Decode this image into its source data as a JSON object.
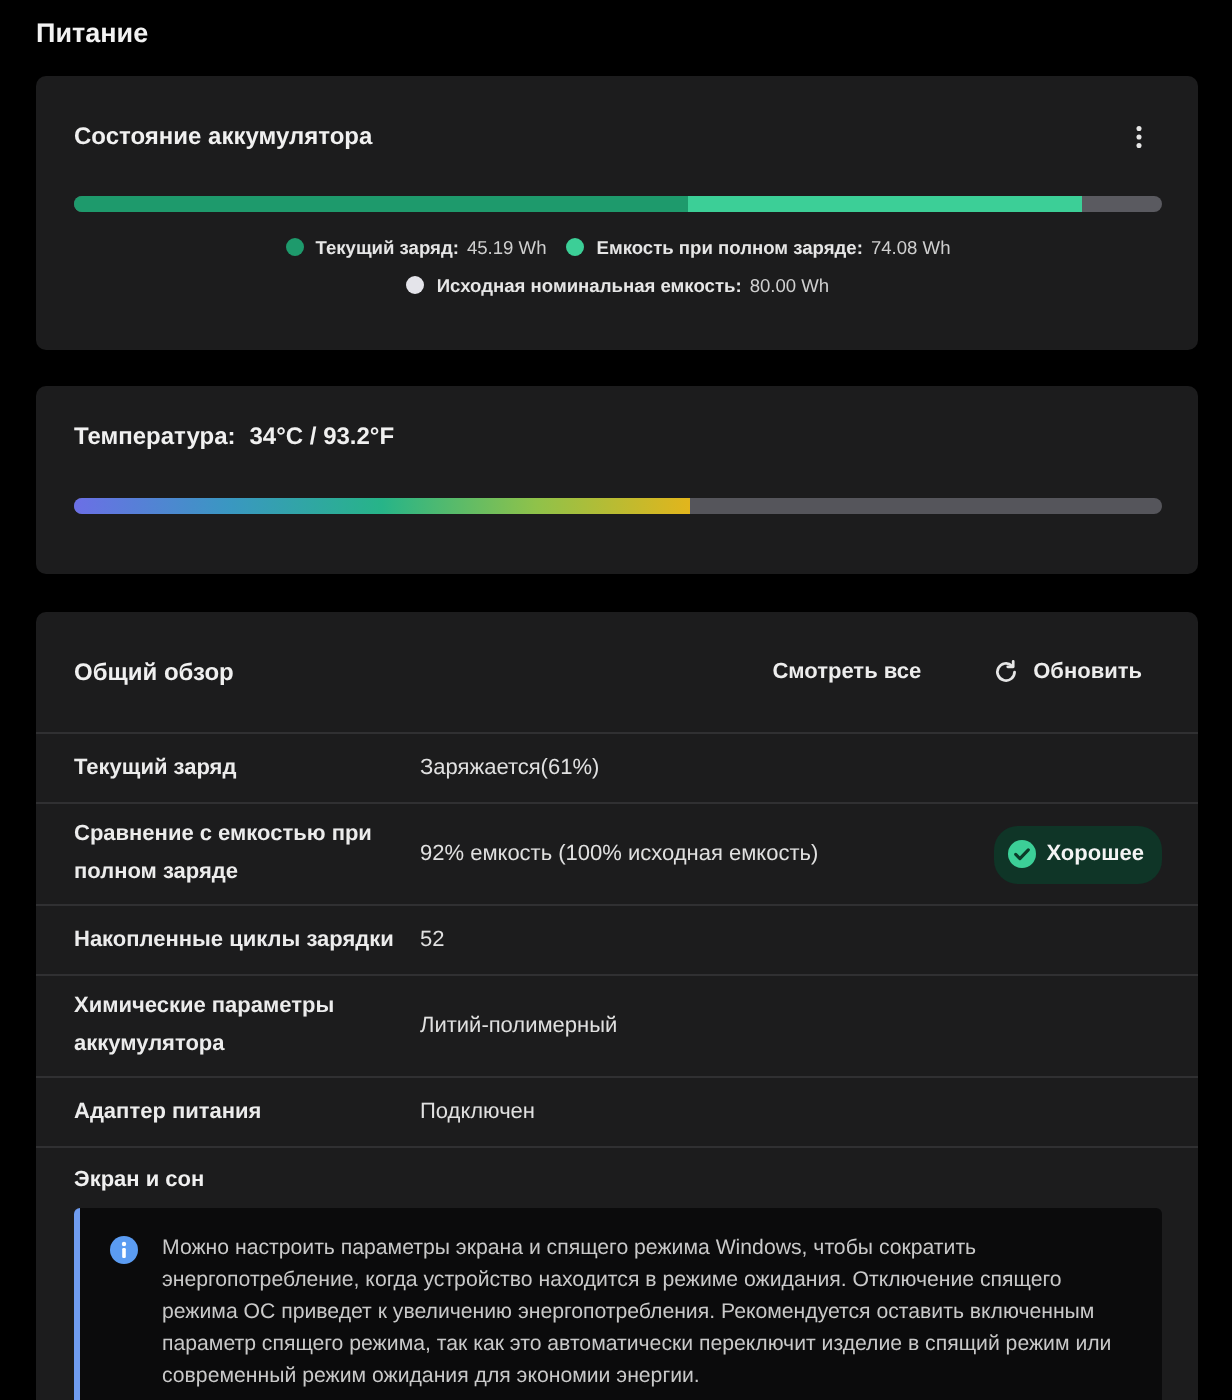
{
  "page": {
    "title": "Питание"
  },
  "battery_status": {
    "title": "Состояние аккумулятора",
    "legend": [
      {
        "label": "Текущий заряд:",
        "value": "45.19 Wh",
        "color": "#1e9a6c",
        "level": 0.565
      },
      {
        "label": "Емкость при полном заряде:",
        "value": "74.08 Wh",
        "color": "#3ccf97",
        "level": 0.926
      },
      {
        "label": "Исходная номинальная емкость:",
        "value": "80.00 Wh",
        "color": "#e4e4ea"
      }
    ]
  },
  "temperature": {
    "label": "Температура:",
    "value": "34°C / 93.2°F",
    "level": 0.566
  },
  "overview": {
    "title": "Общий обзор",
    "actions": [
      {
        "label": "Смотреть все",
        "kind": "link"
      },
      {
        "label": "Обновить",
        "kind": "refresh"
      }
    ],
    "rows": [
      {
        "label": "Текущий заряд",
        "value": "Заряжается(61%)"
      },
      {
        "label": "Сравнение с емкостью при полном заряде",
        "value": "92% емкость (100% исходная емкость)",
        "badge": {
          "label": "Хорошее",
          "kind": "good"
        }
      },
      {
        "label": "Накопленные циклы зарядки",
        "value": "52"
      },
      {
        "label": "Химические параметры аккумулятора",
        "value": "Литий-полимерный"
      },
      {
        "label": "Адаптер питания",
        "value": "Подключен"
      }
    ],
    "section": {
      "title": "Экран и сон",
      "note": "Можно настроить параметры экрана и спящего режима Windows, чтобы сократить энергопотребление, когда устройство находится в режиме ожидания. Отключение спящего режима ОС приведет к увеличению энергопотребления. Рекомендуется оставить включенным параметр спящего режима, так как это автоматически переключит изделие в спящий режим или современный режим ожидания для экономии энергии."
    }
  }
}
